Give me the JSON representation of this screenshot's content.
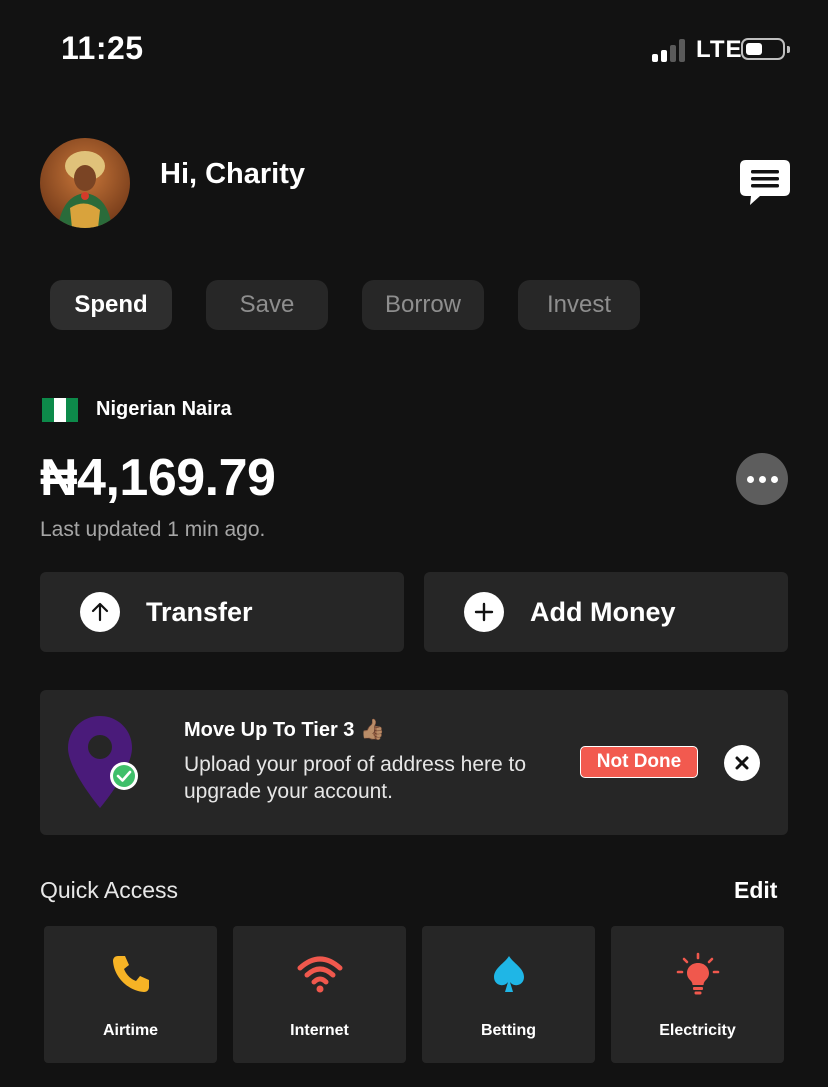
{
  "status_bar": {
    "time": "11:25",
    "network": "LTE",
    "signal_bars": 2,
    "battery_level": 0.4
  },
  "header": {
    "greeting": "Hi, Charity",
    "avatar_icon": "user-avatar",
    "chat_icon": "chat-icon"
  },
  "tabs": [
    {
      "label": "Spend",
      "active": true
    },
    {
      "label": "Save",
      "active": false
    },
    {
      "label": "Borrow",
      "active": false
    },
    {
      "label": "Invest",
      "active": false
    }
  ],
  "account": {
    "currency_name": "Nigerian Naira",
    "balance": "₦4,169.79",
    "last_updated": "Last updated 1 min ago."
  },
  "actions": {
    "transfer_label": "Transfer",
    "add_money_label": "Add Money"
  },
  "tier_card": {
    "title": "Move Up To Tier 3 👍🏽",
    "body": "Upload your proof of address here to upgrade your account.",
    "status": "Not Done"
  },
  "quick_access": {
    "title": "Quick Access",
    "edit_label": "Edit",
    "items": [
      {
        "label": "Airtime",
        "icon": "phone-icon",
        "color": "#f6b325"
      },
      {
        "label": "Internet",
        "icon": "wifi-icon",
        "color": "#f0584d"
      },
      {
        "label": "Betting",
        "icon": "spade-icon",
        "color": "#1fb6e6"
      },
      {
        "label": "Electricity",
        "icon": "bulb-icon",
        "color": "#f0584d"
      }
    ]
  },
  "colors": {
    "background": "#121212",
    "surface": "#262626",
    "accent_red": "#f25a4f",
    "pin_purple": "#4a1b7a",
    "check_green": "#3fbf6a",
    "flag_green": "#0d8a4a"
  }
}
